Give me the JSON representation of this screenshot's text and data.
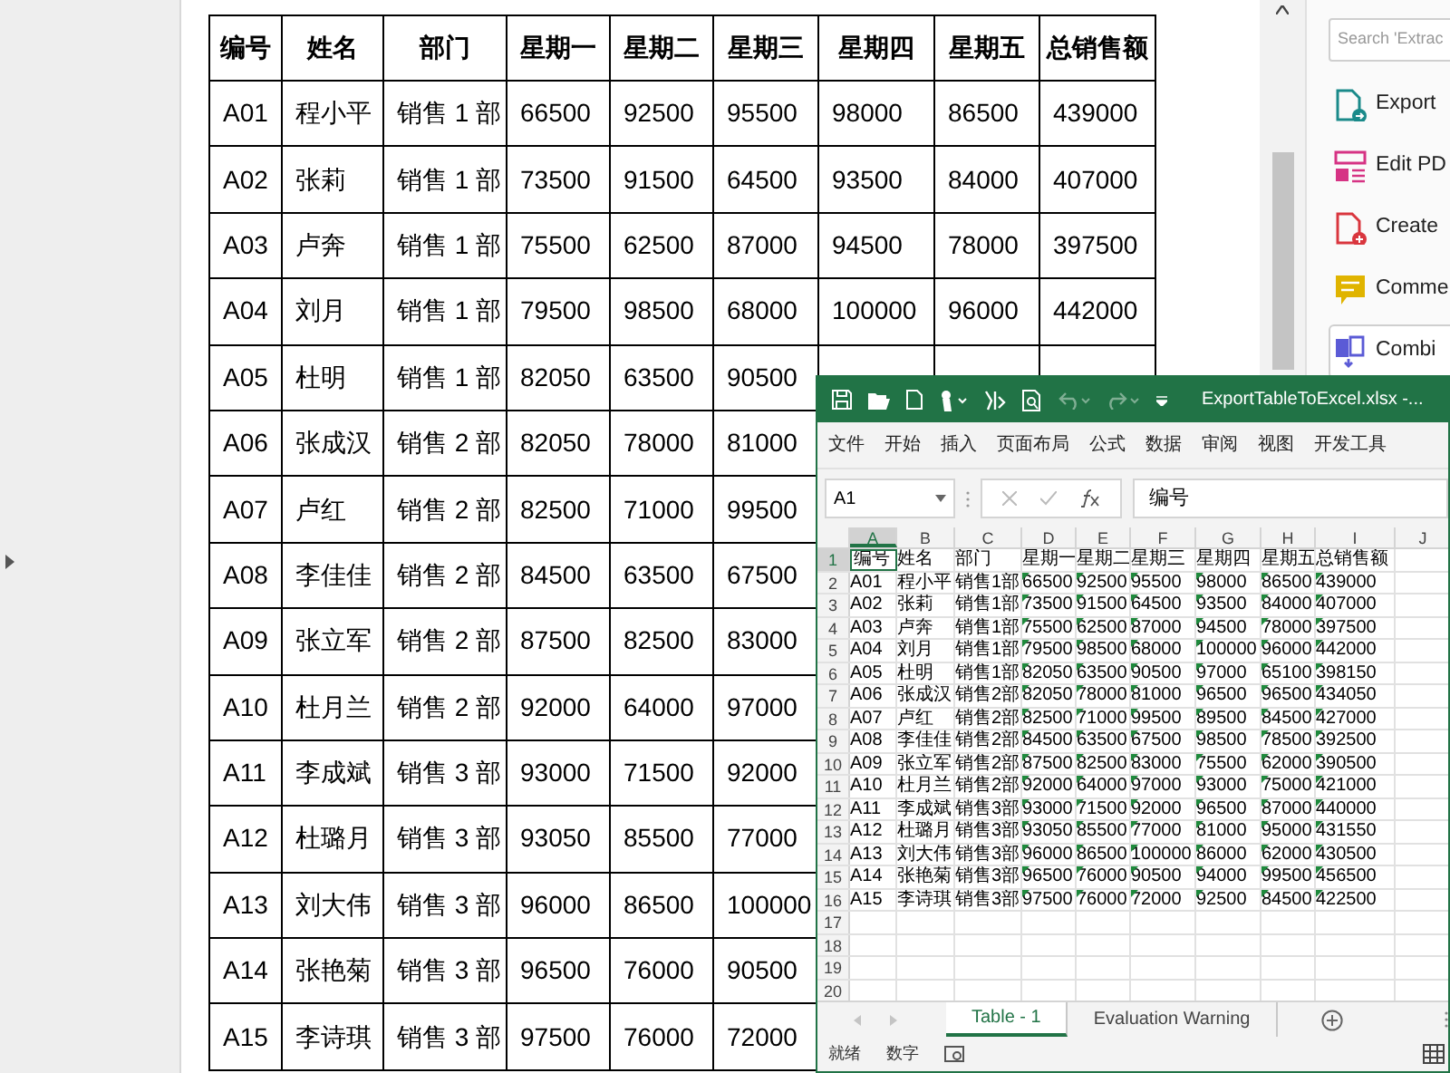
{
  "pdf_viewer": {
    "table": {
      "columns": [
        "编号",
        "姓名",
        "部门",
        "星期一",
        "星期二",
        "星期三",
        "星期四",
        "星期五",
        "总销售额"
      ],
      "rows": [
        {
          "cells": [
            "A01",
            "程小平",
            "销售 1 部",
            "66500",
            "92500",
            "95500",
            "98000",
            "86500",
            "439000"
          ]
        },
        {
          "cells": [
            "A02",
            "张莉",
            "销售 1 部",
            "73500",
            "91500",
            "64500",
            "93500",
            "84000",
            "407000"
          ]
        },
        {
          "cells": [
            "A03",
            "卢奔",
            "销售 1 部",
            "75500",
            "62500",
            "87000",
            "94500",
            "78000",
            "397500"
          ]
        },
        {
          "cells": [
            "A04",
            "刘月",
            "销售 1 部",
            "79500",
            "98500",
            "68000",
            "100000",
            "96000",
            "442000"
          ]
        },
        {
          "cells": [
            "A05",
            "杜明",
            "销售 1 部",
            "82050",
            "63500",
            "90500"
          ]
        },
        {
          "cells": [
            "A06",
            "张成汉",
            "销售 2 部",
            "82050",
            "78000",
            "81000"
          ]
        },
        {
          "cells": [
            "A07",
            "卢红",
            "销售 2 部",
            "82500",
            "71000",
            "99500"
          ]
        },
        {
          "cells": [
            "A08",
            "李佳佳",
            "销售 2 部",
            "84500",
            "63500",
            "67500"
          ]
        },
        {
          "cells": [
            "A09",
            "张立军",
            "销售 2 部",
            "87500",
            "82500",
            "83000"
          ]
        },
        {
          "cells": [
            "A10",
            "杜月兰",
            "销售 2 部",
            "92000",
            "64000",
            "97000"
          ]
        },
        {
          "cells": [
            "A11",
            "李成斌",
            "销售 3 部",
            "93000",
            "71500",
            "92000"
          ]
        },
        {
          "cells": [
            "A12",
            "杜璐月",
            "销售 3 部",
            "93050",
            "85500",
            "77000"
          ]
        },
        {
          "cells": [
            "A13",
            "刘大伟",
            "销售 3 部",
            "96000",
            "86500",
            "100000"
          ]
        },
        {
          "cells": [
            "A14",
            "张艳菊",
            "销售 3 部",
            "96500",
            "76000",
            "90500"
          ]
        },
        {
          "cells": [
            "A15",
            "李诗琪",
            "销售 3 部",
            "97500",
            "76000",
            "72000"
          ]
        }
      ]
    },
    "tools_panel": {
      "search": {
        "placeholder": "Search 'Extrac"
      },
      "tools": [
        {
          "kind": "export",
          "label": "Export",
          "selected": false
        },
        {
          "kind": "edit",
          "label": "Edit PD",
          "selected": false
        },
        {
          "kind": "create",
          "label": "Create",
          "selected": false
        },
        {
          "kind": "comment",
          "label": "Comme",
          "selected": false
        },
        {
          "kind": "combine",
          "label": "Combi",
          "selected": true
        }
      ]
    }
  },
  "excel": {
    "title": "ExportTableToExcel.xlsx -...",
    "menu": [
      "文件",
      "开始",
      "插入",
      "页面布局",
      "公式",
      "数据",
      "审阅",
      "视图",
      "开发工具"
    ],
    "name_box": "A1",
    "formula": "编号",
    "sheet": {
      "number_as_text_warnings": true,
      "columns": [
        {
          "label": "A",
          "selected": true
        },
        {
          "label": "B",
          "selected": false
        },
        {
          "label": "C",
          "selected": false
        },
        {
          "label": "D",
          "selected": false
        },
        {
          "label": "E",
          "selected": false
        },
        {
          "label": "F",
          "selected": false
        },
        {
          "label": "G",
          "selected": false
        },
        {
          "label": "H",
          "selected": false
        },
        {
          "label": "I",
          "selected": false
        },
        {
          "label": "J",
          "selected": false
        }
      ],
      "row_numbers": [
        {
          "label": "1",
          "selected": true
        },
        {
          "label": "2",
          "selected": false
        },
        {
          "label": "3",
          "selected": false
        },
        {
          "label": "4",
          "selected": false
        },
        {
          "label": "5",
          "selected": false
        },
        {
          "label": "6",
          "selected": false
        },
        {
          "label": "7",
          "selected": false
        },
        {
          "label": "8",
          "selected": false
        },
        {
          "label": "9",
          "selected": false
        },
        {
          "label": "10",
          "selected": false
        },
        {
          "label": "11",
          "selected": false
        },
        {
          "label": "12",
          "selected": false
        },
        {
          "label": "13",
          "selected": false
        },
        {
          "label": "14",
          "selected": false
        },
        {
          "label": "15",
          "selected": false
        },
        {
          "label": "16",
          "selected": false
        },
        {
          "label": "17",
          "selected": false
        },
        {
          "label": "18",
          "selected": false
        },
        {
          "label": "19",
          "selected": false
        },
        {
          "label": "20",
          "selected": false
        }
      ],
      "rows": [
        [
          "编号",
          "姓名",
          "部门",
          "星期一",
          "星期二",
          "星期三",
          "星期四",
          "星期五",
          "总销售额"
        ],
        [
          "A01",
          "程小平",
          "销售1部",
          "66500",
          "92500",
          "95500",
          "98000",
          "86500",
          "439000"
        ],
        [
          "A02",
          "张莉",
          "销售1部",
          "73500",
          "91500",
          "64500",
          "93500",
          "84000",
          "407000"
        ],
        [
          "A03",
          "卢奔",
          "销售1部",
          "75500",
          "62500",
          "87000",
          "94500",
          "78000",
          "397500"
        ],
        [
          "A04",
          "刘月",
          "销售1部",
          "79500",
          "98500",
          "68000",
          "100000",
          "96000",
          "442000"
        ],
        [
          "A05",
          "杜明",
          "销售1部",
          "82050",
          "63500",
          "90500",
          "97000",
          "65100",
          "398150"
        ],
        [
          "A06",
          "张成汉",
          "销售2部",
          "82050",
          "78000",
          "81000",
          "96500",
          "96500",
          "434050"
        ],
        [
          "A07",
          "卢红",
          "销售2部",
          "82500",
          "71000",
          "99500",
          "89500",
          "84500",
          "427000"
        ],
        [
          "A08",
          "李佳佳",
          "销售2部",
          "84500",
          "63500",
          "67500",
          "98500",
          "78500",
          "392500"
        ],
        [
          "A09",
          "张立军",
          "销售2部",
          "87500",
          "82500",
          "83000",
          "75500",
          "62000",
          "390500"
        ],
        [
          "A10",
          "杜月兰",
          "销售2部",
          "92000",
          "64000",
          "97000",
          "93000",
          "75000",
          "421000"
        ],
        [
          "A11",
          "李成斌",
          "销售3部",
          "93000",
          "71500",
          "92000",
          "96500",
          "87000",
          "440000"
        ],
        [
          "A12",
          "杜璐月",
          "销售3部",
          "93050",
          "85500",
          "77000",
          "81000",
          "95000",
          "431550"
        ],
        [
          "A13",
          "刘大伟",
          "销售3部",
          "96000",
          "86500",
          "100000",
          "86000",
          "62000",
          "430500"
        ],
        [
          "A14",
          "张艳菊",
          "销售3部",
          "96500",
          "76000",
          "90500",
          "94000",
          "99500",
          "456500"
        ],
        [
          "A15",
          "李诗琪",
          "销售3部",
          "97500",
          "76000",
          "72000",
          "92500",
          "84500",
          "422500"
        ]
      ]
    },
    "sheet_tabs": [
      {
        "label": "Table - 1",
        "selected": true
      },
      {
        "label": "Evaluation Warning",
        "selected": false
      }
    ],
    "status": [
      "就绪",
      "数字"
    ]
  }
}
